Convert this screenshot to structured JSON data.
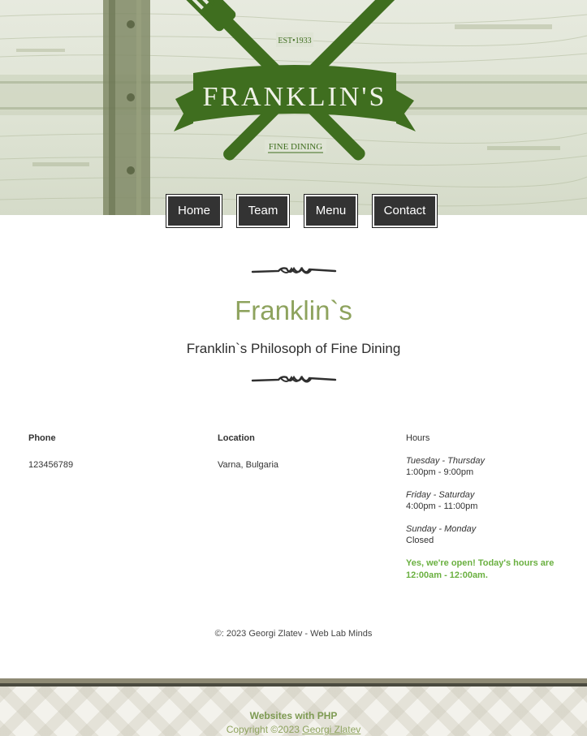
{
  "colors": {
    "brand_green": "#8ea35e",
    "logo_green": "#3f6e1f",
    "open_green": "#6ab040",
    "nav_bg": "#333333"
  },
  "logo": {
    "name": "FRANKLIN'S",
    "est": "EST•1933",
    "tagline": "FINE DINING"
  },
  "nav": {
    "items": [
      {
        "label": "Home"
      },
      {
        "label": "Team"
      },
      {
        "label": "Menu"
      },
      {
        "label": "Contact"
      }
    ]
  },
  "main": {
    "title": "Franklin`s",
    "subtitle": "Franklin`s Philosoph of Fine Dining"
  },
  "info": {
    "phone": {
      "label": "Phone",
      "value": "123456789"
    },
    "location": {
      "label": "Location",
      "value": "Varna, Bulgaria"
    },
    "hours": {
      "label": "Hours",
      "schedule": [
        {
          "days": "Tuesday - Thursday",
          "time": "1:00pm - 9:00pm"
        },
        {
          "days": "Friday - Saturday",
          "time": "4:00pm - 11:00pm"
        },
        {
          "days": "Sunday - Monday",
          "time": "Closed"
        }
      ],
      "open_note": "Yes, we're open! Today's hours are 12:00am - 12:00am."
    }
  },
  "footer": {
    "copyright": "©: 2023 Georgi Zlatev - Web Lab Minds",
    "bottom_title": "Websites with PHP",
    "bottom_copy_prefix": "Copyright ©2023 ",
    "bottom_copy_link": "Georgi Zlatev"
  }
}
